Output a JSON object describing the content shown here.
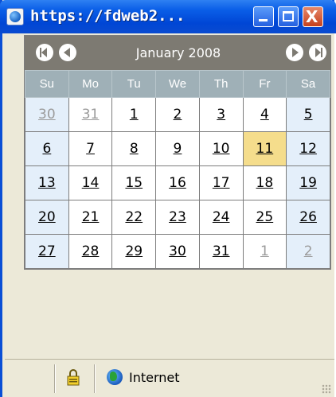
{
  "window": {
    "title": "https://fdweb2...",
    "controls": {
      "minimize": "minimize",
      "maximize": "maximize",
      "close": "X"
    }
  },
  "calendar": {
    "month_title": "January 2008",
    "weekdays": [
      "Su",
      "Mo",
      "Tu",
      "We",
      "Th",
      "Fr",
      "Sa"
    ],
    "weeks": [
      [
        {
          "d": "30",
          "other": true
        },
        {
          "d": "31",
          "other": true
        },
        {
          "d": "1"
        },
        {
          "d": "2"
        },
        {
          "d": "3"
        },
        {
          "d": "4"
        },
        {
          "d": "5"
        }
      ],
      [
        {
          "d": "6"
        },
        {
          "d": "7"
        },
        {
          "d": "8"
        },
        {
          "d": "9"
        },
        {
          "d": "10"
        },
        {
          "d": "11",
          "today": true
        },
        {
          "d": "12"
        }
      ],
      [
        {
          "d": "13"
        },
        {
          "d": "14"
        },
        {
          "d": "15"
        },
        {
          "d": "16"
        },
        {
          "d": "17"
        },
        {
          "d": "18"
        },
        {
          "d": "19"
        }
      ],
      [
        {
          "d": "20"
        },
        {
          "d": "21"
        },
        {
          "d": "22"
        },
        {
          "d": "23"
        },
        {
          "d": "24"
        },
        {
          "d": "25"
        },
        {
          "d": "26"
        }
      ],
      [
        {
          "d": "27"
        },
        {
          "d": "28"
        },
        {
          "d": "29"
        },
        {
          "d": "30"
        },
        {
          "d": "31"
        },
        {
          "d": "1",
          "other": true
        },
        {
          "d": "2",
          "other": true
        }
      ]
    ],
    "nav_icons": [
      "prev-year-icon",
      "prev-month-icon",
      "next-month-icon",
      "next-year-icon"
    ],
    "colors": {
      "header": "#7d7a72",
      "weekday_row": "#9fb0b7",
      "weekend": "#e4effa",
      "today": "#f5dd8c"
    }
  },
  "statusbar": {
    "zone": "Internet",
    "icons": [
      "lock-icon",
      "globe-icon"
    ]
  }
}
